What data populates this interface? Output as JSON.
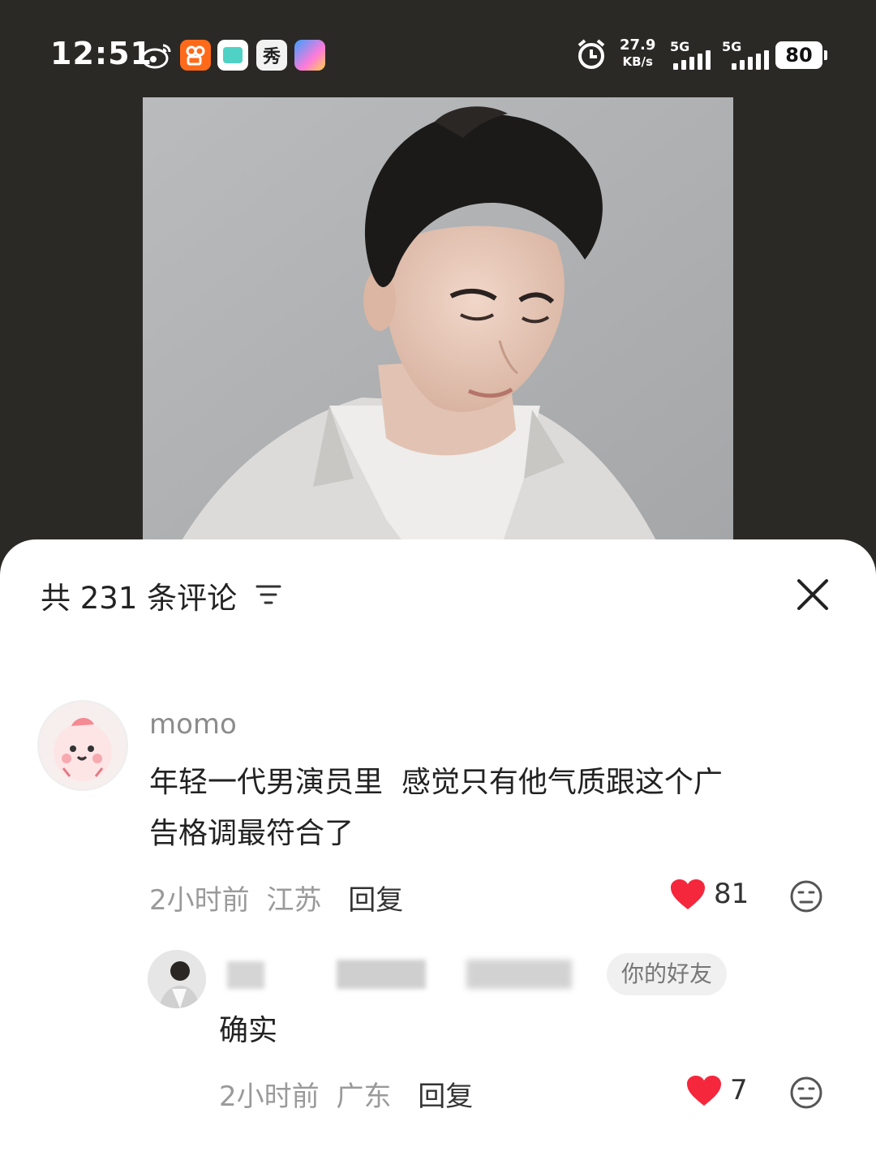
{
  "status_bar": {
    "time": "12:51",
    "apps": [
      "weibo-icon",
      "kuaishou-icon",
      "app-icon",
      "xiu-icon",
      "app-store-icon"
    ],
    "app3_label": "秀",
    "net_speed_value": "27.9",
    "net_speed_unit": "KB/s",
    "signal1_label": "5G",
    "signal2_label": "5G",
    "battery": "80"
  },
  "comments_panel": {
    "title": "共 231 条评论"
  },
  "comments": [
    {
      "username": "momo",
      "text_line1": "年轻一代男演员里  感觉只有他气质跟这个广",
      "text_line2": "告格调最符合了",
      "time": "2小时前",
      "location": "江苏",
      "reply_label": "回复",
      "likes": "81"
    }
  ],
  "reply": {
    "friend_badge": "你的好友",
    "text": "确实",
    "time": "2小时前",
    "location": "广东",
    "reply_label": "回复",
    "likes": "7"
  },
  "colors": {
    "heart": "#f5273c",
    "background_dark": "#2b2926"
  }
}
